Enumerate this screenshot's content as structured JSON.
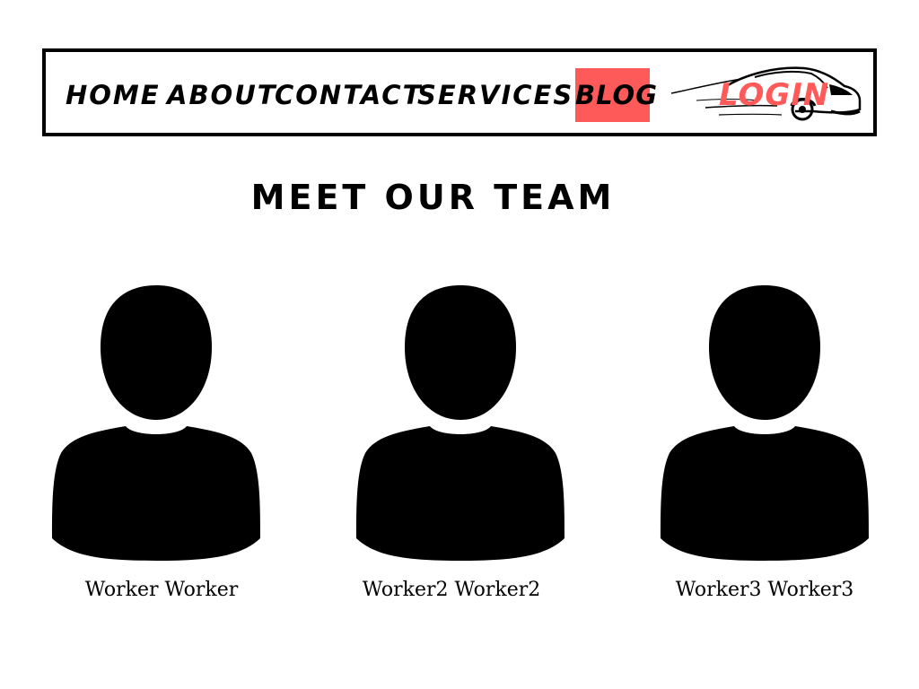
{
  "nav": {
    "items": [
      {
        "label": "HOME"
      },
      {
        "label": "ABOUT"
      },
      {
        "label": "CONTACT"
      },
      {
        "label": "SERVICES"
      },
      {
        "label": "BLOG",
        "active": true
      }
    ],
    "login_label": "LOGIN",
    "logo_icon": "car-icon",
    "active_color": "#ff5a5a",
    "login_color": "#ff5a5a"
  },
  "main": {
    "title": "MEET OUR TEAM",
    "team": [
      {
        "name": "Worker Worker",
        "avatar_icon": "user-silhouette-icon"
      },
      {
        "name": "Worker2 Worker2",
        "avatar_icon": "user-silhouette-icon"
      },
      {
        "name": "Worker3 Worker3",
        "avatar_icon": "user-silhouette-icon"
      }
    ]
  }
}
